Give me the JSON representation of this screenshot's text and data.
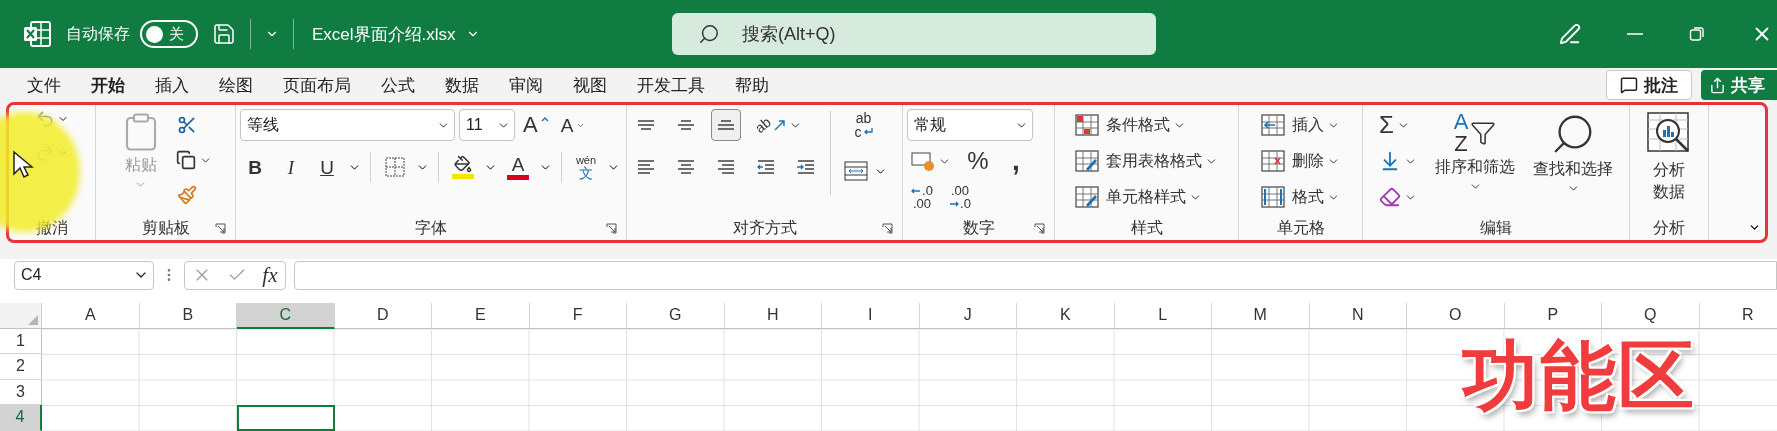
{
  "title_bar": {
    "autosave_label": "自动保存",
    "autosave": {
      "on": false,
      "label": "关"
    },
    "file_name": "Excel界面介绍.xlsx",
    "search": {
      "placeholder": "搜索(Alt+Q)"
    }
  },
  "tabs": [
    {
      "label": "文件",
      "selected": false
    },
    {
      "label": "开始",
      "selected": true
    },
    {
      "label": "插入",
      "selected": false
    },
    {
      "label": "绘图",
      "selected": false
    },
    {
      "label": "页面布局",
      "selected": false
    },
    {
      "label": "公式",
      "selected": false
    },
    {
      "label": "数据",
      "selected": false
    },
    {
      "label": "审阅",
      "selected": false
    },
    {
      "label": "视图",
      "selected": false
    },
    {
      "label": "开发工具",
      "selected": false
    },
    {
      "label": "帮助",
      "selected": false
    }
  ],
  "comment_button": "批注",
  "share_button": "共享",
  "ribbon": {
    "highlighted": true,
    "groups": [
      {
        "kind": "undo",
        "label": "撤消",
        "launcher": false
      },
      {
        "kind": "clipboard",
        "label": "剪贴板",
        "launcher": true,
        "paste_label": "粘贴"
      },
      {
        "kind": "font",
        "label": "字体",
        "launcher": true,
        "font_name": "等线",
        "font_size": "11",
        "grow_glyph": "A",
        "shrink_glyph": "A",
        "buttons": [
          {
            "kind": "bold",
            "glyph": "B"
          },
          {
            "kind": "italic",
            "glyph": "I"
          },
          {
            "kind": "underline",
            "glyph": "U"
          }
        ],
        "color_buttons": [
          {
            "kind": "fill",
            "color": "#f2e600"
          },
          {
            "kind": "font_color",
            "glyph": "A",
            "color": "#d9001b"
          }
        ],
        "phonetic": {
          "ruby": "wén",
          "base": "文"
        }
      },
      {
        "kind": "alignment",
        "label": "对齐方式",
        "launcher": true,
        "vertical": [
          {
            "kind": "top",
            "selected": false
          },
          {
            "kind": "middle",
            "selected": false
          },
          {
            "kind": "bottom",
            "selected": true
          }
        ],
        "orientation_glyph": "ab",
        "horizontal": [
          {
            "kind": "left",
            "selected": false
          },
          {
            "kind": "center",
            "selected": false
          },
          {
            "kind": "right",
            "selected": false
          },
          {
            "kind": "outdent",
            "selected": false
          },
          {
            "kind": "indent",
            "selected": false
          }
        ],
        "wrap_glyph": {
          "top": "ab",
          "bottom": "c"
        }
      },
      {
        "kind": "number",
        "label": "数字",
        "launcher": true,
        "format": "常规",
        "percent_glyph": "%",
        "comma_glyph": ",",
        "decimal_buttons": [
          {
            "kind": "increase",
            "top": ".0",
            "bottom": ".00"
          },
          {
            "kind": "decrease",
            "top": ".00",
            "bottom": ".0"
          }
        ]
      },
      {
        "kind": "styles",
        "label": "样式",
        "launcher": false,
        "items": [
          {
            "kind": "conditional",
            "label": "条件格式"
          },
          {
            "kind": "table",
            "label": "套用表格格式"
          },
          {
            "kind": "cell_style",
            "label": "单元格样式"
          }
        ]
      },
      {
        "kind": "cells",
        "label": "单元格",
        "launcher": false,
        "items": [
          {
            "kind": "insert",
            "label": "插入"
          },
          {
            "kind": "delete",
            "label": "删除"
          },
          {
            "kind": "format",
            "label": "格式"
          }
        ]
      },
      {
        "kind": "editing",
        "label": "编辑",
        "launcher": false,
        "sum_glyph": "Σ",
        "sort": {
          "label": "排序和筛选",
          "glyphs": [
            "A",
            "Z"
          ]
        },
        "find": {
          "label": "查找和选择"
        }
      },
      {
        "kind": "analysis",
        "label": "分析",
        "launcher": false,
        "button": "分析数据"
      }
    ]
  },
  "formula_bar": {
    "name_box": "C4",
    "function_label": "fx"
  },
  "sheet": {
    "columns": [
      {
        "label": "A",
        "selected": false
      },
      {
        "label": "B",
        "selected": false
      },
      {
        "label": "C",
        "selected": true
      },
      {
        "label": "D",
        "selected": false
      },
      {
        "label": "E",
        "selected": false
      },
      {
        "label": "F",
        "selected": false
      },
      {
        "label": "G",
        "selected": false
      },
      {
        "label": "H",
        "selected": false
      },
      {
        "label": "I",
        "selected": false
      },
      {
        "label": "J",
        "selected": false
      },
      {
        "label": "K",
        "selected": false
      },
      {
        "label": "L",
        "selected": false
      },
      {
        "label": "M",
        "selected": false
      },
      {
        "label": "N",
        "selected": false
      },
      {
        "label": "O",
        "selected": false
      },
      {
        "label": "P",
        "selected": false
      },
      {
        "label": "Q",
        "selected": false
      },
      {
        "label": "R",
        "selected": false
      }
    ],
    "rows": [
      {
        "label": "1",
        "selected": false
      },
      {
        "label": "2",
        "selected": false
      },
      {
        "label": "3",
        "selected": false
      },
      {
        "label": "4",
        "selected": true
      }
    ]
  },
  "annotation": {
    "text": "功能区"
  }
}
